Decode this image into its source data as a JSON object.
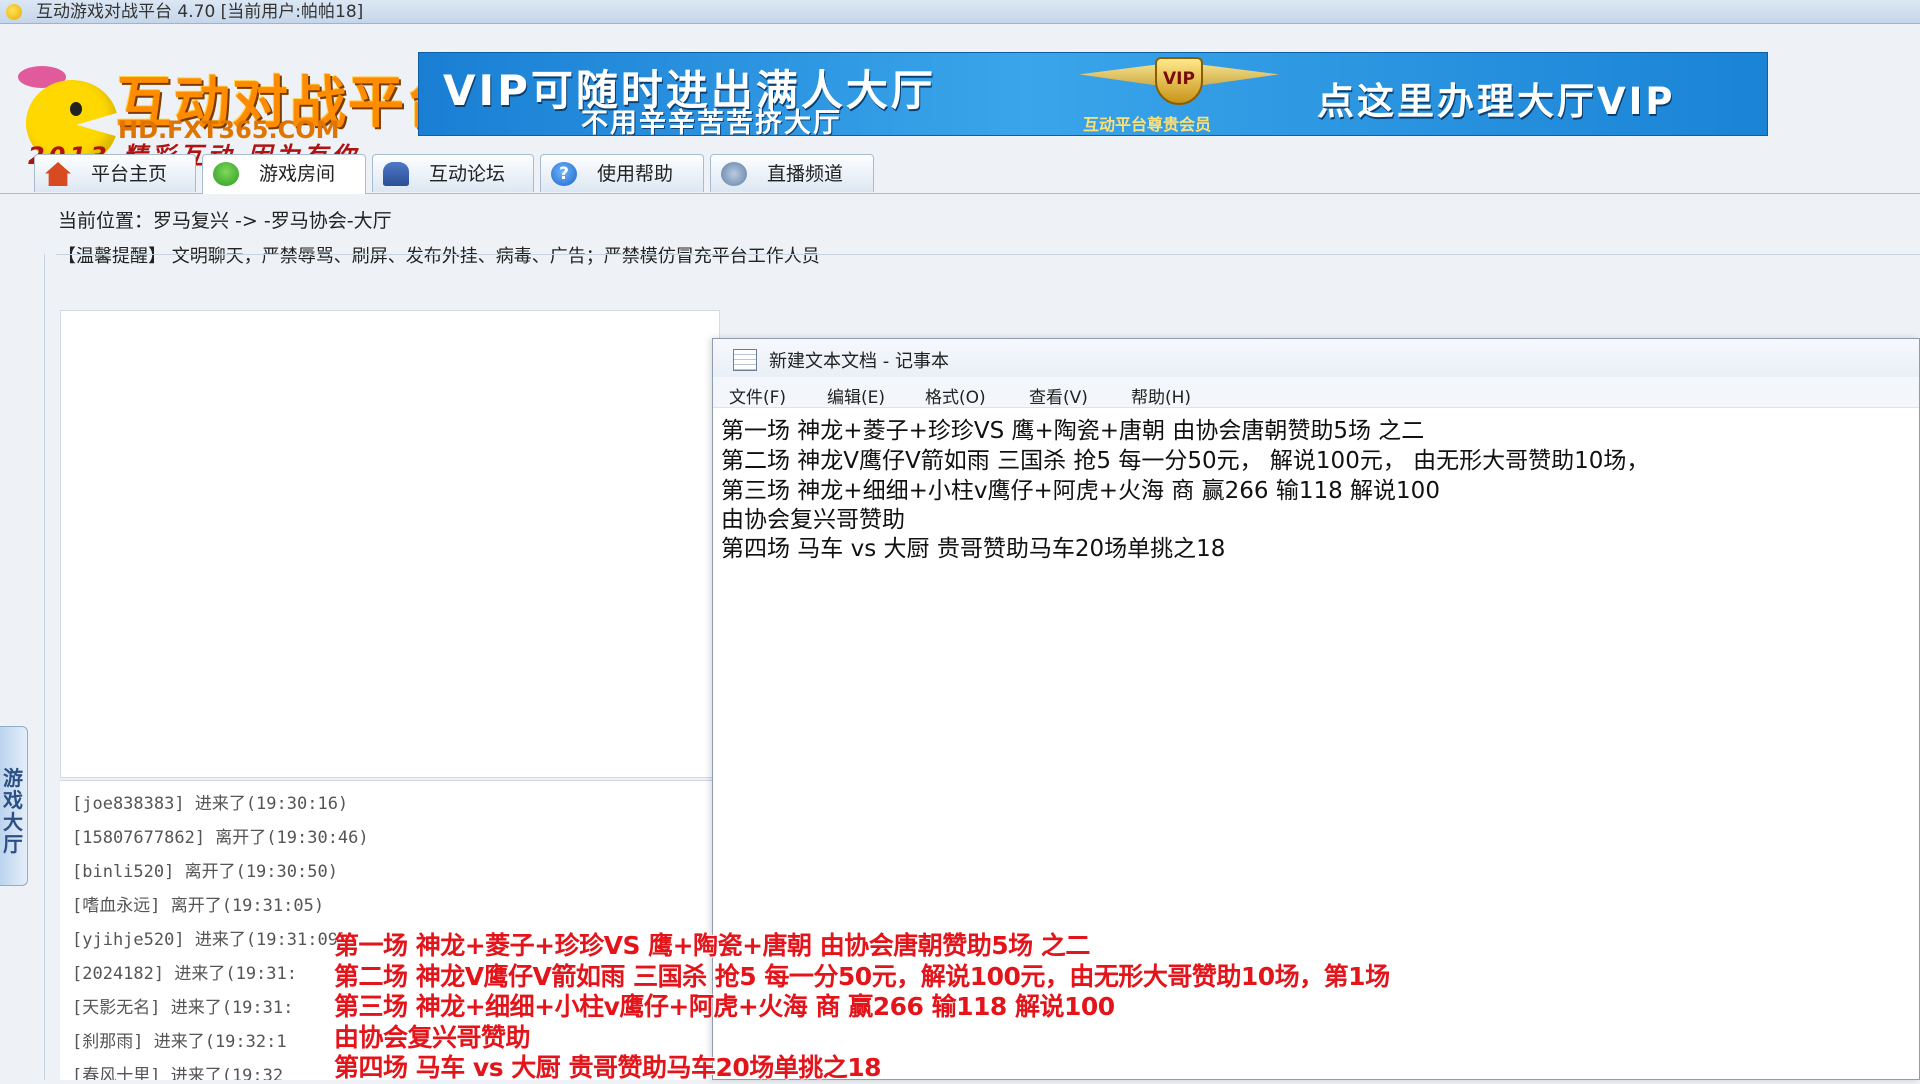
{
  "window": {
    "title": "互动游戏对战平台 4.70 [当前用户:帕帕18]"
  },
  "logo": {
    "title": "互动对战平台",
    "url": "HD.FXT365.COM",
    "slogan": "2013 精彩互动 因为有你"
  },
  "banner": {
    "line1": "VIP可随时进出满人大厅",
    "line2": "不用辛辛苦苦挤大厅",
    "vip_badge": "VIP",
    "vip_sub": "互动平台尊贵会员",
    "right_text": "点这里办理大厅VIP"
  },
  "tabs": [
    {
      "label": "平台主页",
      "icon": "home-icon"
    },
    {
      "label": "游戏房间",
      "icon": "game-room-icon"
    },
    {
      "label": "互动论坛",
      "icon": "forum-icon"
    },
    {
      "label": "使用帮助",
      "icon": "help-icon",
      "glyph": "?"
    },
    {
      "label": "直播频道",
      "icon": "live-channel-icon"
    }
  ],
  "location": "当前位置：罗马复兴 -> -罗马协会-大厅",
  "reminder": "【温馨提醒】 文明聊天，严禁辱骂、刷屏、发布外挂、病毒、广告；严禁模仿冒充平台工作人员",
  "side_tab": "游戏大厅",
  "log": [
    "[joe838383] 进来了(19:30:16)",
    "[15807677862] 离开了(19:30:46)",
    "[binli520] 离开了(19:30:50)",
    "[嗜血永远] 离开了(19:31:05)",
    "[yjihje520] 进来了(19:31:09)",
    "[2024182] 进来了(19:31:",
    "[天影无名] 进来了(19:31:",
    "[刹那雨] 进来了(19:32:1",
    "[春风十里] 进来了(19:32"
  ],
  "notepad": {
    "title": "新建文本文档 - 记事本",
    "menu": [
      "文件(F)",
      "编辑(E)",
      "格式(O)",
      "查看(V)",
      "帮助(H)"
    ],
    "lines": [
      "第一场 神龙+菱子+珍珍VS 鹰+陶瓷+唐朝    由协会唐朝赞助5场 之二",
      "第二场  神龙V鹰仔V箭如雨   三国杀  抢5  每一分50元， 解说100元， 由无形大哥赞助10场，",
      "第三场  神龙+细细+小柱v鹰仔+阿虎+火海  商  赢266  输118  解说100",
      "由协会复兴哥赞助",
      "第四场  马车 vs 大厨  贵哥赞助马车20场单挑之18"
    ]
  },
  "overlay": [
    "第一场 神龙+菱子+珍珍VS 鹰+陶瓷+唐朝   由协会唐朝赞助5场 之二",
    "第二场 神龙V鹰仔V箭如雨  三国杀  抢5  每一分50元，解说100元，由无形大哥赞助10场，第1场",
    "第三场 神龙+细细+小柱v鹰仔+阿虎+火海  商  赢266  输118  解说100",
    "由协会复兴哥赞助",
    "第四场  马车 vs 大厨  贵哥赞助马车20场单挑之18"
  ]
}
